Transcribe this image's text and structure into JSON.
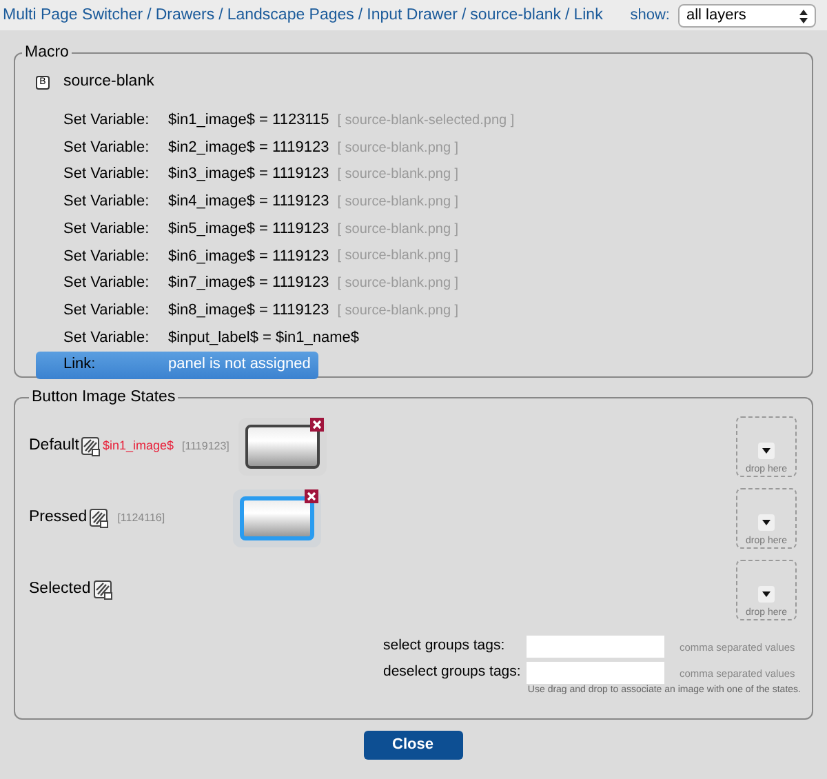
{
  "breadcrumb": [
    "Multi Page Switcher",
    "Drawers",
    "Landscape Pages",
    "Input Drawer",
    "source-blank",
    "Link"
  ],
  "breadcrumb_separator": "/",
  "show": {
    "label": "show:",
    "value": "all layers"
  },
  "macro": {
    "title": "Macro",
    "badge": "B",
    "name": "source-blank",
    "rows": [
      {
        "label": "Set Variable:",
        "value": "$in1_image$ = 1123115",
        "file": "[ source-blank-selected.png ]"
      },
      {
        "label": "Set Variable:",
        "value": "$in2_image$ = 1119123",
        "file": "[ source-blank.png ]"
      },
      {
        "label": "Set Variable:",
        "value": "$in3_image$ = 1119123",
        "file": "[ source-blank.png ]"
      },
      {
        "label": "Set Variable:",
        "value": "$in4_image$ = 1119123",
        "file": "[ source-blank.png ]"
      },
      {
        "label": "Set Variable:",
        "value": "$in5_image$ = 1119123",
        "file": "[ source-blank.png ]"
      },
      {
        "label": "Set Variable:",
        "value": "$in6_image$ = 1119123",
        "file": "[ source-blank.png ]"
      },
      {
        "label": "Set Variable:",
        "value": "$in7_image$ = 1119123",
        "file": "[ source-blank.png ]"
      },
      {
        "label": "Set Variable:",
        "value": "$in8_image$ = 1119123",
        "file": "[ source-blank.png ]"
      },
      {
        "label": "Set Variable:",
        "value": "$input_label$ = $in1_name$"
      }
    ],
    "link": {
      "label": "Link:",
      "value": "panel is not assigned",
      "selected": true
    }
  },
  "states": {
    "title": "Button Image States",
    "items": [
      {
        "label": "Default",
        "variable": "$in1_image$",
        "id": "[1119123]",
        "has_image": true,
        "selected": false,
        "drop": "drop here"
      },
      {
        "label": "Pressed",
        "id": "[1124116]",
        "has_image": true,
        "selected": true,
        "drop": "drop here"
      },
      {
        "label": "Selected",
        "has_image": false,
        "drop": "drop here"
      }
    ],
    "fields": [
      {
        "label": "select groups tags:",
        "hint": "comma separated values"
      },
      {
        "label": "deselect groups tags:",
        "hint": "comma separated values"
      }
    ],
    "note": "Use drag and drop to associate an image with one of the states."
  },
  "close": "Close"
}
